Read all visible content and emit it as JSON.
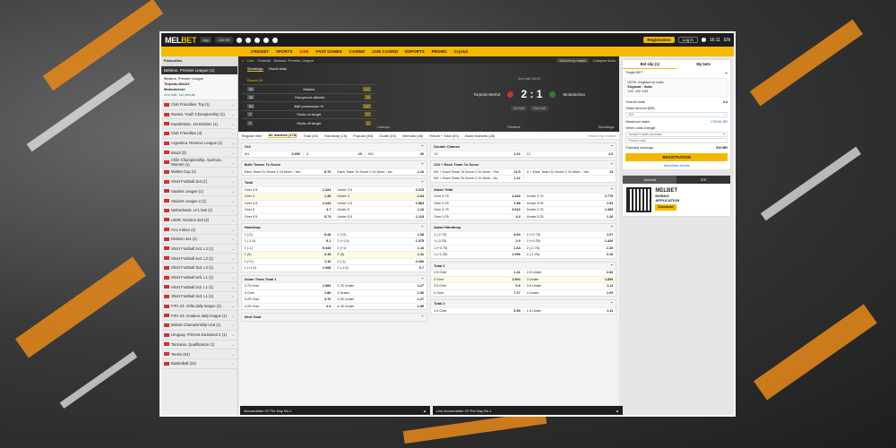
{
  "header": {
    "logo_main": "MEL",
    "logo_accent": "BET",
    "app_label": "App",
    "bonus_label": "100 BR",
    "register": "Registration",
    "login": "Log in",
    "time": "16:11",
    "lang": "EN"
  },
  "nav": [
    "CRICKET",
    "SPORTS",
    "LIVE",
    "FAST GAMES",
    "CASINO",
    "LIVE CASINO",
    "ESPORTS",
    "PROMO",
    "Crystal"
  ],
  "sidebar": {
    "top": "Favourites",
    "header": "Belarus. Premier League (1)",
    "match": {
      "league": "Belarus. Premier League",
      "team1": "Torpedo-BelAZ",
      "team2": "Molodechno",
      "status": "2nd half, 1st minute"
    },
    "items": [
      "Club Friendlies. Top (1)",
      "Russia. Youth Championship (1)",
      "Kazakhstan. 1st Division (1)",
      "Club Friendlies (4)",
      "Argentina. Reserve League (1)",
      "Brazil (3)",
      "Chile Championship. Apertura. Women (1)",
      "Market Cup (1)",
      "Short Football 3x3 (1)",
      "Student League (1)",
      "Student League 2 (1)",
      "Netherlands. LFL 5x5 (1)",
      "LBSR. Division 3x3 (2)",
      "ACL Indoor (1)",
      "Division 4x4 (1)",
      "Short Football 2x2. L2 (1)",
      "Short Football 4x4. L2 (1)",
      "Short Football 3x3. L2 (1)",
      "Short Football 5x5. L1 (1)",
      "Short Football 2x2. L1 (1)",
      "Short Football 3x3. L1 (1)",
      "FIFA 23. Volta daily league (1)",
      "FIFA 23. Amateur daily league (1)",
      "Bolivia Championship U19 (1)",
      "Uruguay. Primera Divisional C (1)",
      "Tanzania. Qualification (1)",
      "Tennis (52)",
      "Basketball (22)"
    ]
  },
  "crumbs": [
    "Live",
    "Football",
    "Belarus. Premier League"
  ],
  "crumb_search": "Search by match",
  "crumb_right": "Collapse block",
  "scoreboard": {
    "tab1": "Standings",
    "tab2": "Visual stats",
    "stats_head": "Round 15",
    "stats": [
      {
        "l": "53",
        "name": "Attacks",
        "r": "42"
      },
      {
        "l": "30",
        "name": "Dangerous attacks",
        "r": "8"
      },
      {
        "l": "54",
        "name": "Ball possession %",
        "r": "46"
      },
      {
        "l": "2",
        "name": "Shots on target",
        "r": "1"
      },
      {
        "l": "0",
        "name": "Shots off target",
        "r": "1"
      }
    ],
    "team1": "Torpedo-BelAZ",
    "team2": "Molodechno",
    "score": "2 : 1",
    "half": "2nd half",
    "minute": "46:01",
    "p1": "1st half",
    "p2": "2nd half",
    "lineups": "Lineups",
    "timeline": "Timeline",
    "standings": "Standings"
  },
  "market_tabs": [
    "Regular time",
    "All markets (278)",
    "Total (44)",
    "Handicap (15)",
    "Popular (84)",
    "Goals (23)",
    "Intervals (46)",
    "Result + Total (20)",
    "Asian markets (28)"
  ],
  "market_search": "Search by market",
  "left_markets": [
    {
      "title": "1X2",
      "rows": [
        [
          [
            "W1",
            "3.456"
          ],
          [
            "X",
            "10"
          ],
          [
            "W2",
            "30"
          ]
        ]
      ]
    },
    {
      "title": "Both Teams To Score",
      "rows": [
        [
          [
            "Each Team To Score 2 Or More - Yes",
            "8.76"
          ],
          [
            "Each Team To Score 2 Or More - No",
            "1.16"
          ]
        ]
      ]
    },
    {
      "title": "Total",
      "rows": [
        [
          [
            "Over 3.5",
            "1.324"
          ],
          [
            "Under 3.5",
            "3.315"
          ]
        ],
        [
          [
            "Over 4",
            "1.48"
          ],
          [
            "Under 4",
            "2.34"
          ],
          "hl"
        ],
        [
          [
            "Over 4.5",
            "2.444"
          ],
          [
            "Under 4.5",
            "1.584"
          ]
        ],
        [
          [
            "Over 5",
            "4.7"
          ],
          [
            "Under 5",
            "1.16"
          ]
        ],
        [
          [
            "Over 5.5",
            "5.73"
          ],
          [
            "Under 5.5",
            "1.115"
          ]
        ]
      ]
    },
    {
      "title": "Handicap",
      "rows": [
        [
          [
            "1 (-2)",
            "8.48"
          ],
          [
            "2 (+2)",
            "1.08"
          ]
        ],
        [
          [
            "1 (-1.5)",
            "8.1"
          ],
          [
            "2 (+1.5)",
            "1.075"
          ]
        ],
        [
          [
            "1 (-1)",
            "5.344"
          ],
          [
            "2 (+1)",
            "1.16"
          ]
        ],
        [
          [
            "1 (0)",
            "3.18"
          ],
          [
            "2 (0)",
            "1.41"
          ],
          "hl"
        ],
        [
          [
            "1 (+1)",
            "1.16"
          ],
          [
            "2 (-1)",
            "2.336"
          ]
        ],
        [
          [
            "1 (+1.5)",
            "1.068"
          ],
          [
            "2 (-1.5)",
            "3.7"
          ]
        ]
      ]
    },
    {
      "title": "Asian Team Total 1",
      "rows": [
        [
          [
            "2.75 Over",
            "1.584"
          ],
          [
            "2.75 Under",
            "2.27"
          ]
        ],
        [
          [
            "3 Over",
            "1.88"
          ],
          [
            "3 Under",
            "1.96"
          ]
        ],
        [
          [
            "3.25 Over",
            "3.76"
          ],
          [
            "3.25 Under",
            "1.27"
          ]
        ],
        [
          [
            "4.25 Over",
            "2.4"
          ],
          [
            "4.25 Under",
            "1.55"
          ]
        ]
      ]
    },
    {
      "title": "Next Goal",
      "rows": []
    }
  ],
  "right_markets": [
    {
      "title": "Double Chance",
      "rows": [
        [
          [
            "1X",
            "1.02"
          ],
          [
            "12",
            "2.6"
          ]
        ]
      ]
    },
    {
      "title": "1X2 + Each Team To Score",
      "rows": [
        [
          [
            "W1 + Each Team To Score 2 Or More - Yes",
            "11.5"
          ],
          [
            "X + Each Team To Score 2 Or More - Yes",
            "13"
          ]
        ],
        [
          [
            "W1 + Each Team To Score 2 Or More - No",
            "1.22"
          ],
          [
            "",
            ""
          ]
        ]
      ]
    },
    {
      "title": "Asian Total",
      "rows": [
        [
          [
            "Over 3.75",
            "1.440"
          ],
          [
            "Under 3.75",
            "2.775"
          ]
        ],
        [
          [
            "Over 4.25",
            "1.88"
          ],
          [
            "Under 4.25",
            "1.93"
          ]
        ],
        [
          [
            "Over 4.75",
            "3.016"
          ],
          [
            "Under 4.75",
            "1.385"
          ]
        ],
        [
          [
            "Over 5.25",
            "4.4"
          ],
          [
            "Under 5.25",
            "1.16"
          ]
        ]
      ]
    },
    {
      "title": "Asian Handicap",
      "rows": [
        [
          [
            "1 (-2.75)",
            "8.54"
          ],
          [
            "2 (+2.75)",
            "1.07"
          ]
        ],
        [
          [
            "1 (-0.25)",
            "2.9"
          ],
          [
            "2 (+0.25)",
            "1.426"
          ]
        ],
        [
          [
            "1 (+0.75)",
            "1.64"
          ],
          [
            "2 (-0.75)",
            "2.26"
          ]
        ],
        [
          [
            "1 (+1.25)",
            "1.056"
          ],
          [
            "2 (-1.25)",
            "3.16"
          ]
        ]
      ]
    },
    {
      "title": "Total 1",
      "rows": [
        [
          [
            "2.5 Over",
            "1.41"
          ],
          [
            "2.5 Under",
            "2.82"
          ]
        ],
        [
          [
            "3 Over",
            "1.904"
          ],
          [
            "3 Under",
            "1.896"
          ],
          "hl"
        ],
        [
          [
            "3.5 Over",
            "6.6"
          ],
          [
            "3.5 Under",
            "1.11"
          ]
        ],
        [
          [
            "4 Over",
            "7.27"
          ],
          [
            "4 Under",
            "1.09"
          ]
        ]
      ]
    },
    {
      "title": "Total 2",
      "rows": [
        [
          [
            "1.5 Over",
            "6.95"
          ],
          [
            "1.5 Under",
            "1.11"
          ]
        ]
      ]
    }
  ],
  "bottom": {
    "left": "Accumulator Of The Day No.1",
    "right": "Live Accumulator Of The Day No.1"
  },
  "betslip": {
    "tab1": "Bet slip (1)",
    "tab2": "My bets",
    "single": "Single BET",
    "selection": {
      "league": "UEFA. England vs India",
      "event": "England - India",
      "pick": "1X2. W2",
      "odd": "1.52"
    },
    "odds_label": "Overall odds",
    "odds_value": "3.4",
    "stake_label": "Stake amount (BR)",
    "stake_value": "100",
    "max_label": "Maximum stake",
    "max_value": "170000 BR",
    "change_label": "When odds change:",
    "change_value": "Accept if odds increase",
    "promo": "Promo code",
    "payout_label": "Potential winnings",
    "payout_value": "510 BR",
    "register": "REGISTRATION",
    "save": "Save/load events"
  },
  "app_promo": {
    "tab1": "Android",
    "tab2": "iOS",
    "brand": "MELBET",
    "line1": "MOBILE",
    "line2": "APPLICATION",
    "download": "Download"
  }
}
